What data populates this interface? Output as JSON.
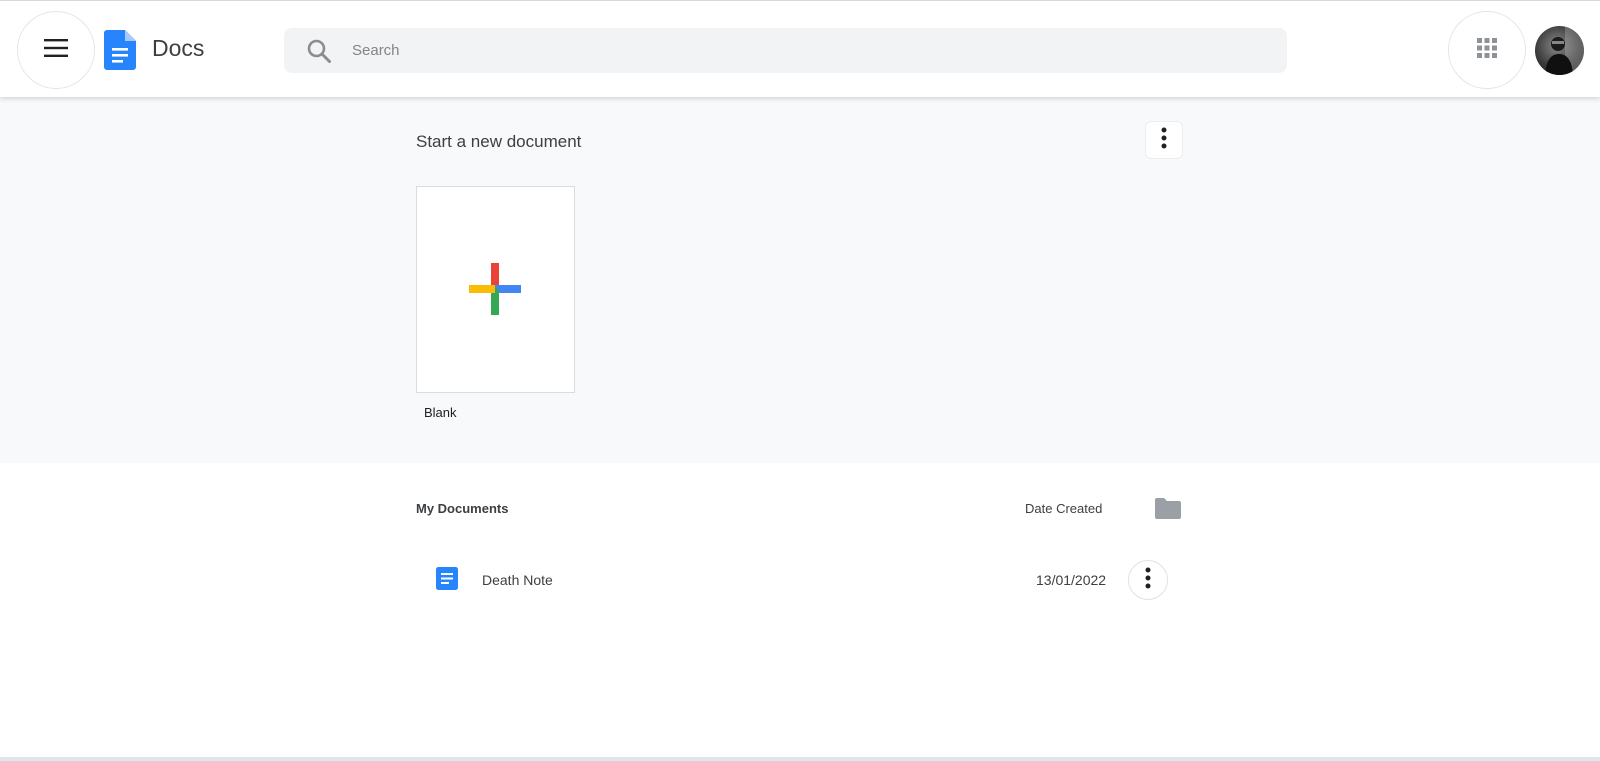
{
  "header": {
    "app_title": "Docs",
    "menu_icon": "hamburger-menu-icon",
    "logo_icon": "docs-logo-icon",
    "search": {
      "placeholder": "Search",
      "value": ""
    },
    "apps_icon": "apps-grid-icon",
    "brand_color": "#2684fc"
  },
  "templates": {
    "title": "Start a new document",
    "items": [
      {
        "label": "Blank"
      }
    ],
    "plus_colors": {
      "top": "#ea4335",
      "right": "#4285f4",
      "bottom": "#34a853",
      "left": "#fbbc04"
    }
  },
  "documents": {
    "title": "My Documents",
    "date_header": "Date Created",
    "folder_icon": "folder-icon",
    "rows": [
      {
        "name": "Death Note",
        "date": "13/01/2022"
      }
    ]
  }
}
